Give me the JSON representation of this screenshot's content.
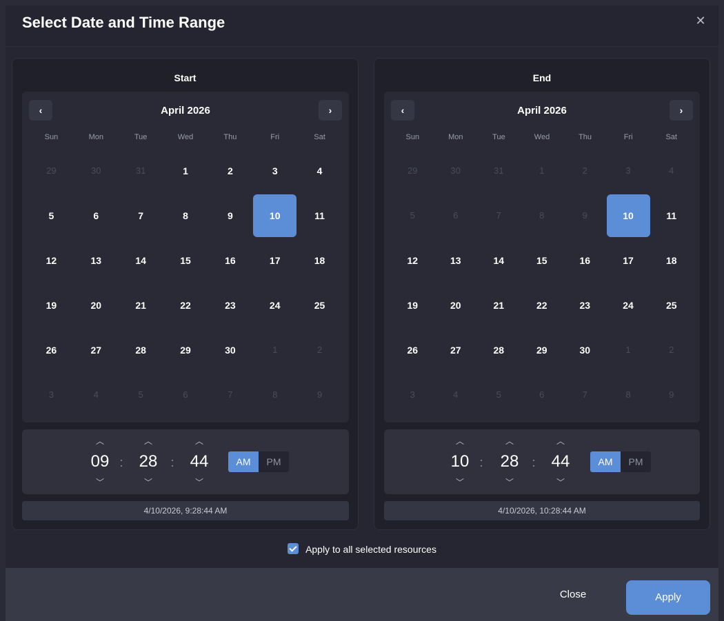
{
  "dialog": {
    "title": "Select Date and Time Range",
    "close_icon": "close-icon"
  },
  "weekdays": [
    "Sun",
    "Mon",
    "Tue",
    "Wed",
    "Thu",
    "Fri",
    "Sat"
  ],
  "start": {
    "label": "Start",
    "month": "April 2026",
    "prev_icon": "chevron-left-icon",
    "next_icon": "chevron-right-icon",
    "days": [
      {
        "d": "29",
        "m": true
      },
      {
        "d": "30",
        "m": true
      },
      {
        "d": "31",
        "m": true
      },
      {
        "d": "1"
      },
      {
        "d": "2"
      },
      {
        "d": "3"
      },
      {
        "d": "4"
      },
      {
        "d": "5"
      },
      {
        "d": "6"
      },
      {
        "d": "7"
      },
      {
        "d": "8"
      },
      {
        "d": "9"
      },
      {
        "d": "10",
        "s": true
      },
      {
        "d": "11"
      },
      {
        "d": "12"
      },
      {
        "d": "13"
      },
      {
        "d": "14"
      },
      {
        "d": "15"
      },
      {
        "d": "16"
      },
      {
        "d": "17"
      },
      {
        "d": "18"
      },
      {
        "d": "19"
      },
      {
        "d": "20"
      },
      {
        "d": "21"
      },
      {
        "d": "22"
      },
      {
        "d": "23"
      },
      {
        "d": "24"
      },
      {
        "d": "25"
      },
      {
        "d": "26"
      },
      {
        "d": "27"
      },
      {
        "d": "28"
      },
      {
        "d": "29"
      },
      {
        "d": "30"
      },
      {
        "d": "1",
        "m": true
      },
      {
        "d": "2",
        "m": true
      },
      {
        "d": "3",
        "m": true
      },
      {
        "d": "4",
        "m": true
      },
      {
        "d": "5",
        "m": true
      },
      {
        "d": "6",
        "m": true
      },
      {
        "d": "7",
        "m": true
      },
      {
        "d": "8",
        "m": true
      },
      {
        "d": "9",
        "m": true
      }
    ],
    "hour": "09",
    "minute": "28",
    "second": "44",
    "am": "AM",
    "pm": "PM",
    "period_selected": "AM",
    "summary": "4/10/2026, 9:28:44 AM"
  },
  "end": {
    "label": "End",
    "month": "April 2026",
    "prev_icon": "chevron-left-icon",
    "next_icon": "chevron-right-icon",
    "days": [
      {
        "d": "29",
        "m": true
      },
      {
        "d": "30",
        "m": true
      },
      {
        "d": "31",
        "m": true
      },
      {
        "d": "1",
        "m": true
      },
      {
        "d": "2",
        "m": true
      },
      {
        "d": "3",
        "m": true
      },
      {
        "d": "4",
        "m": true
      },
      {
        "d": "5",
        "m": true
      },
      {
        "d": "6",
        "m": true
      },
      {
        "d": "7",
        "m": true
      },
      {
        "d": "8",
        "m": true
      },
      {
        "d": "9",
        "m": true
      },
      {
        "d": "10",
        "s": true
      },
      {
        "d": "11"
      },
      {
        "d": "12"
      },
      {
        "d": "13"
      },
      {
        "d": "14"
      },
      {
        "d": "15"
      },
      {
        "d": "16"
      },
      {
        "d": "17"
      },
      {
        "d": "18"
      },
      {
        "d": "19"
      },
      {
        "d": "20"
      },
      {
        "d": "21"
      },
      {
        "d": "22"
      },
      {
        "d": "23"
      },
      {
        "d": "24"
      },
      {
        "d": "25"
      },
      {
        "d": "26"
      },
      {
        "d": "27"
      },
      {
        "d": "28"
      },
      {
        "d": "29"
      },
      {
        "d": "30"
      },
      {
        "d": "1",
        "m": true
      },
      {
        "d": "2",
        "m": true
      },
      {
        "d": "3",
        "m": true
      },
      {
        "d": "4",
        "m": true
      },
      {
        "d": "5",
        "m": true
      },
      {
        "d": "6",
        "m": true
      },
      {
        "d": "7",
        "m": true
      },
      {
        "d": "8",
        "m": true
      },
      {
        "d": "9",
        "m": true
      }
    ],
    "hour": "10",
    "minute": "28",
    "second": "44",
    "am": "AM",
    "pm": "PM",
    "period_selected": "AM",
    "summary": "4/10/2026, 10:28:44 AM"
  },
  "apply_all": {
    "label": "Apply to all selected resources",
    "checked": true
  },
  "footer": {
    "close_label": "Close",
    "apply_label": "Apply"
  },
  "colors": {
    "accent": "#5b8ed6",
    "background": "#252631"
  }
}
